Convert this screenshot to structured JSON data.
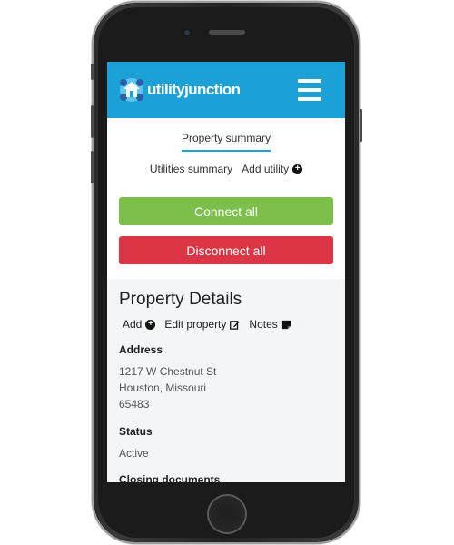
{
  "brand": {
    "logo_text": "utilityjunction"
  },
  "tabs": {
    "active": "Property summary"
  },
  "subtabs": {
    "utilities_summary": "Utilities summary",
    "add_utility": "Add utility"
  },
  "buttons": {
    "connect_all": "Connect all",
    "disconnect_all": "Disconnect all"
  },
  "details": {
    "title": "Property Details",
    "actions": {
      "add": "Add",
      "edit_property": "Edit property",
      "notes": "Notes"
    },
    "address_label": "Address",
    "address_line1": "1217 W Chestnut St",
    "address_line2": "Houston, Missouri",
    "address_line3": "65483",
    "status_label": "Status",
    "status_value": "Active",
    "closing_label": "Closing documents"
  },
  "colors": {
    "header": "#1ba1d6",
    "connect": "#7cbf4b",
    "disconnect": "#dc3545",
    "panel": "#f4f5f7"
  },
  "icons": [
    "home-logo-icon",
    "hamburger-menu-icon",
    "plus-circle-icon",
    "edit-icon",
    "note-icon"
  ]
}
